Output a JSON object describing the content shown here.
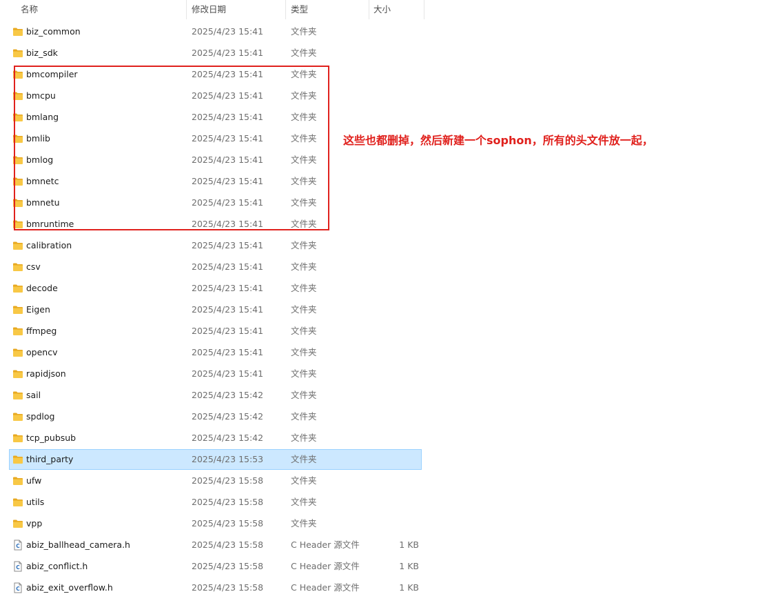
{
  "columns": {
    "name": "名称",
    "date": "修改日期",
    "type": "类型",
    "size": "大小"
  },
  "sort_indicator": "^",
  "rows": [
    {
      "name": "biz_common",
      "date": "2025/4/23 15:41",
      "type": "文件夹",
      "size": "",
      "icon": "folder-icon"
    },
    {
      "name": "biz_sdk",
      "date": "2025/4/23 15:41",
      "type": "文件夹",
      "size": "",
      "icon": "folder-icon"
    },
    {
      "name": "bmcompiler",
      "date": "2025/4/23 15:41",
      "type": "文件夹",
      "size": "",
      "icon": "folder-icon"
    },
    {
      "name": "bmcpu",
      "date": "2025/4/23 15:41",
      "type": "文件夹",
      "size": "",
      "icon": "folder-icon"
    },
    {
      "name": "bmlang",
      "date": "2025/4/23 15:41",
      "type": "文件夹",
      "size": "",
      "icon": "folder-icon"
    },
    {
      "name": "bmlib",
      "date": "2025/4/23 15:41",
      "type": "文件夹",
      "size": "",
      "icon": "folder-icon"
    },
    {
      "name": "bmlog",
      "date": "2025/4/23 15:41",
      "type": "文件夹",
      "size": "",
      "icon": "folder-icon"
    },
    {
      "name": "bmnetc",
      "date": "2025/4/23 15:41",
      "type": "文件夹",
      "size": "",
      "icon": "folder-icon"
    },
    {
      "name": "bmnetu",
      "date": "2025/4/23 15:41",
      "type": "文件夹",
      "size": "",
      "icon": "folder-icon"
    },
    {
      "name": "bmruntime",
      "date": "2025/4/23 15:41",
      "type": "文件夹",
      "size": "",
      "icon": "folder-icon"
    },
    {
      "name": "calibration",
      "date": "2025/4/23 15:41",
      "type": "文件夹",
      "size": "",
      "icon": "folder-icon"
    },
    {
      "name": "csv",
      "date": "2025/4/23 15:41",
      "type": "文件夹",
      "size": "",
      "icon": "folder-icon"
    },
    {
      "name": "decode",
      "date": "2025/4/23 15:41",
      "type": "文件夹",
      "size": "",
      "icon": "folder-icon"
    },
    {
      "name": "Eigen",
      "date": "2025/4/23 15:41",
      "type": "文件夹",
      "size": "",
      "icon": "folder-icon"
    },
    {
      "name": "ffmpeg",
      "date": "2025/4/23 15:41",
      "type": "文件夹",
      "size": "",
      "icon": "folder-icon"
    },
    {
      "name": "opencv",
      "date": "2025/4/23 15:41",
      "type": "文件夹",
      "size": "",
      "icon": "folder-icon"
    },
    {
      "name": "rapidjson",
      "date": "2025/4/23 15:41",
      "type": "文件夹",
      "size": "",
      "icon": "folder-icon"
    },
    {
      "name": "sail",
      "date": "2025/4/23 15:42",
      "type": "文件夹",
      "size": "",
      "icon": "folder-icon"
    },
    {
      "name": "spdlog",
      "date": "2025/4/23 15:42",
      "type": "文件夹",
      "size": "",
      "icon": "folder-icon"
    },
    {
      "name": "tcp_pubsub",
      "date": "2025/4/23 15:42",
      "type": "文件夹",
      "size": "",
      "icon": "folder-icon"
    },
    {
      "name": "third_party",
      "date": "2025/4/23 15:53",
      "type": "文件夹",
      "size": "",
      "icon": "folder-icon",
      "selected": true
    },
    {
      "name": "ufw",
      "date": "2025/4/23 15:58",
      "type": "文件夹",
      "size": "",
      "icon": "folder-icon"
    },
    {
      "name": "utils",
      "date": "2025/4/23 15:58",
      "type": "文件夹",
      "size": "",
      "icon": "folder-icon"
    },
    {
      "name": "vpp",
      "date": "2025/4/23 15:58",
      "type": "文件夹",
      "size": "",
      "icon": "folder-icon"
    },
    {
      "name": "abiz_ballhead_camera.h",
      "date": "2025/4/23 15:58",
      "type": "C Header 源文件",
      "size": "1 KB",
      "icon": "c-header-file-icon"
    },
    {
      "name": "abiz_conflict.h",
      "date": "2025/4/23 15:58",
      "type": "C Header 源文件",
      "size": "1 KB",
      "icon": "c-header-file-icon"
    },
    {
      "name": "abiz_exit_overflow.h",
      "date": "2025/4/23 15:58",
      "type": "C Header 源文件",
      "size": "1 KB",
      "icon": "c-header-file-icon"
    }
  ],
  "annotation": {
    "text": "这些也都删掉，然后新建一个sophon，所有的头文件放一起，",
    "color": "#e0201c"
  },
  "colors": {
    "selection": "#cce8ff",
    "folder": "#f8c846",
    "highlight_box": "#e0201c"
  }
}
